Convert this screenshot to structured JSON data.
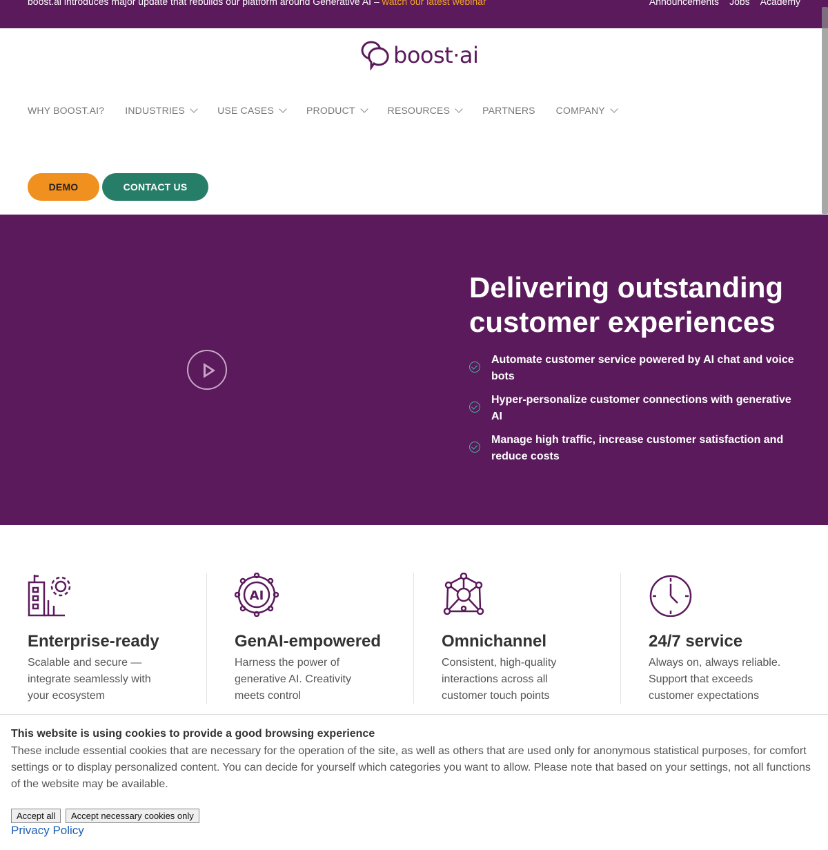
{
  "topbar": {
    "message": "boost.ai introduces major update that rebuilds our platform around Generative AI – ",
    "message_link": "watch our latest webinar",
    "links": [
      "Announcements",
      "Jobs",
      "Academy"
    ]
  },
  "logo": {
    "text": "boost·ai"
  },
  "nav": {
    "items": [
      {
        "label": "WHY BOOST.AI?",
        "dropdown": false
      },
      {
        "label": "INDUSTRIES",
        "dropdown": true
      },
      {
        "label": "USE CASES",
        "dropdown": true
      },
      {
        "label": "PRODUCT",
        "dropdown": true
      },
      {
        "label": "RESOURCES",
        "dropdown": true
      },
      {
        "label": "PARTNERS",
        "dropdown": false
      },
      {
        "label": "COMPANY",
        "dropdown": true
      }
    ]
  },
  "buttons": {
    "demo": "DEMO",
    "contact": "CONTACT US"
  },
  "hero": {
    "title": "Delivering outstanding customer experiences",
    "points": [
      "Automate customer service powered by AI chat and voice bots",
      "Hyper-personalize customer connections with generative AI",
      "Manage high traffic, increase customer satisfaction and reduce costs"
    ]
  },
  "features": [
    {
      "icon": "enterprise-building-gear-icon",
      "title": "Enterprise-ready",
      "text": "Scalable and secure — integrate seamlessly with your ecosystem"
    },
    {
      "icon": "ai-chip-icon",
      "title": "GenAI-empowered",
      "text": "Harness the power of generative AI. Creativity meets control"
    },
    {
      "icon": "network-nodes-icon",
      "title": "Omnichannel",
      "text": "Consistent, high-quality interactions across all customer touch points"
    },
    {
      "icon": "clock-icon",
      "title": "24/7 service",
      "text": "Always on, always reliable. Support that exceeds customer expectations"
    }
  ],
  "cookie": {
    "title": "This website is using cookies to provide a good browsing experience",
    "text": "These include essential cookies that are necessary for the operation of the site, as well as others that are used only for anonymous statistical purposes, for comfort settings or to display personalized content. You can decide for yourself which categories you want to allow. Please note that based on your settings, not all functions of the website may be available.",
    "accept_all": "Accept all",
    "accept_necessary": "Accept necessary cookies only",
    "privacy": "Privacy Policy"
  },
  "colors": {
    "brand_purple": "#5a1a5b",
    "accent_orange": "#f0901f",
    "accent_green": "#267d68",
    "check_teal": "#48b6a3"
  }
}
